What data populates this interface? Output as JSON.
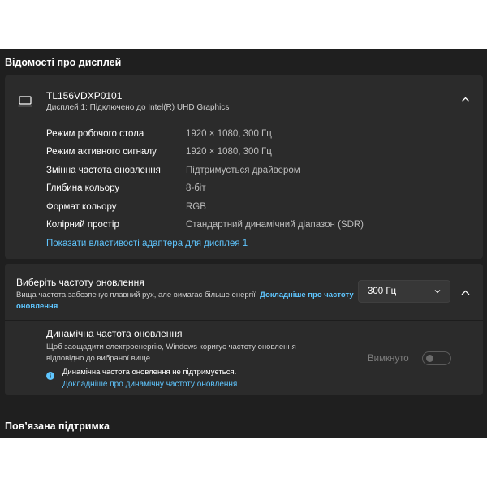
{
  "display_info": {
    "section_title": "Відомості про дисплей",
    "device_name": "TL156VDXP0101",
    "device_subtitle": "Дисплей 1: Підключено до Intel(R) UHD Graphics",
    "rows": [
      {
        "label": "Режим робочого стола",
        "value": "1920 × 1080, 300 Гц"
      },
      {
        "label": "Режим активного сигналу",
        "value": "1920 × 1080, 300 Гц"
      },
      {
        "label": "Змінна частота оновлення",
        "value": "Підтримується драйвером"
      },
      {
        "label": "Глибина кольору",
        "value": "8-біт"
      },
      {
        "label": "Формат кольору",
        "value": "RGB"
      },
      {
        "label": "Колірний простір",
        "value": "Стандартний динамічний діапазон (SDR)"
      }
    ],
    "adapter_link": "Показати властивості адаптера для дисплея 1"
  },
  "refresh_rate": {
    "title": "Виберіть частоту оновлення",
    "description": "Вища частота забезпечує плавний рух, але вимагає більше енергії",
    "learn_more_link": "Докладніше про частоту оновлення",
    "selected_value": "300 Гц"
  },
  "dynamic_refresh": {
    "title": "Динамічна частота оновлення",
    "description": "Щоб заощадити електроенергію, Windows коригує частоту оновлення відповідно до вибраної вище.",
    "warning": "Динамічна частота оновлення не підтримується.",
    "learn_more_link": "Докладніше про динамічну частоту оновлення",
    "toggle_label": "Вимкнуто",
    "toggle_on": false
  },
  "related_support": {
    "section_title": "Пов’язана підтримка"
  },
  "colors": {
    "background": "#1f1f1f",
    "card": "#2b2b2b",
    "accent_link": "#5fc6ff",
    "info_icon": "#5fc6ff"
  }
}
